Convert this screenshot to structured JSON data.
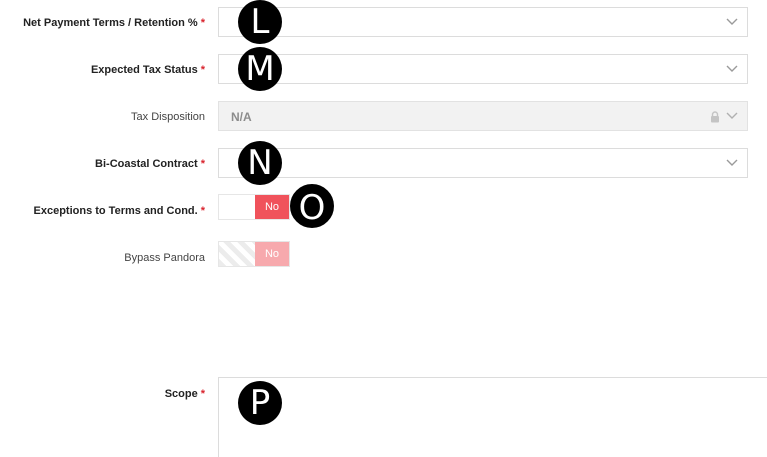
{
  "fields": {
    "net_payment_terms": {
      "label": "Net Payment Terms / Retention %",
      "required": "*",
      "value": ""
    },
    "expected_tax_status": {
      "label": "Expected Tax Status",
      "required": "*",
      "value": ""
    },
    "tax_disposition": {
      "label": "Tax Disposition",
      "value": "N/A"
    },
    "bi_coastal_contract": {
      "label": "Bi-Coastal Contract",
      "required": "*",
      "value": ""
    },
    "exceptions_terms": {
      "label": "Exceptions to Terms and Cond.",
      "required": "*",
      "toggle": "No"
    },
    "bypass_pandora": {
      "label": "Bypass Pandora",
      "toggle": "No"
    },
    "scope": {
      "label": "Scope",
      "required": "*",
      "value": ""
    }
  },
  "markers": {
    "l": "L",
    "m": "M",
    "n": "N",
    "o": "O",
    "p": "P"
  }
}
